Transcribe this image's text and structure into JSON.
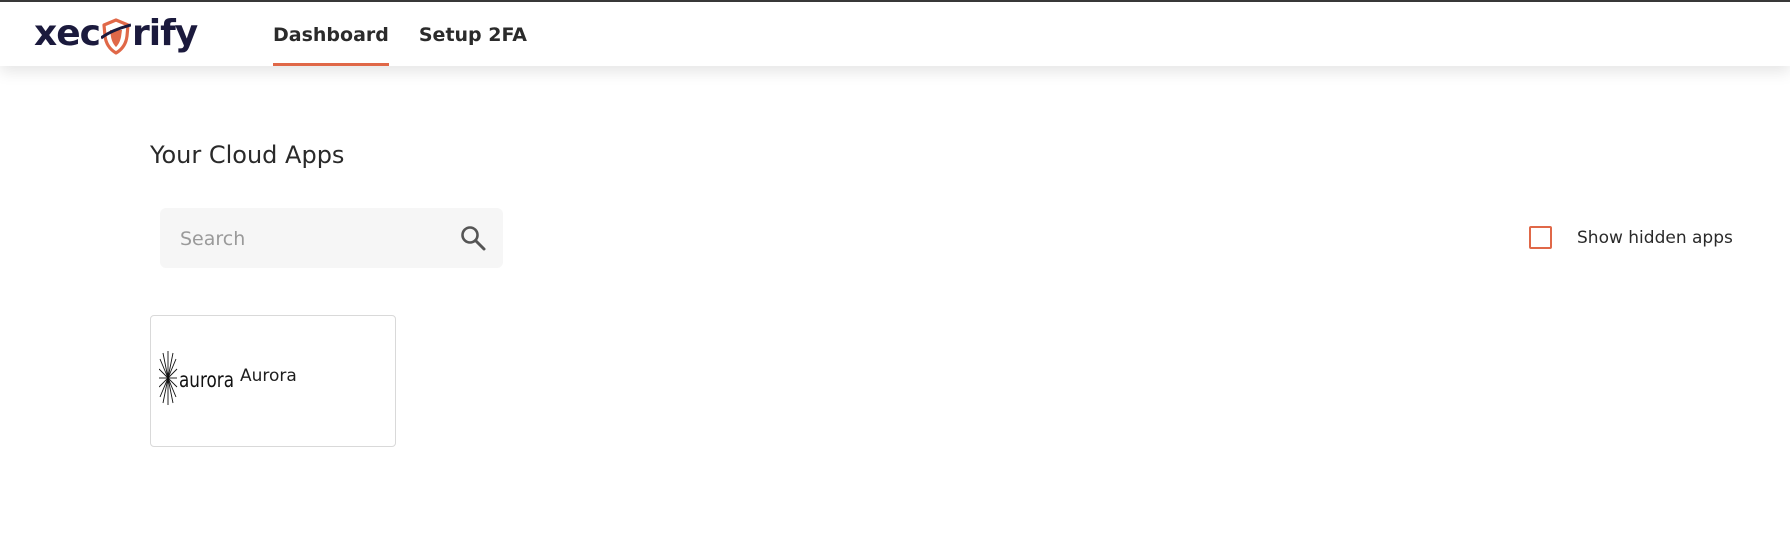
{
  "brand": {
    "logo_text_before": "xec",
    "logo_text_after": "rify",
    "logo_full": "xecurify",
    "primary_color": "#1b1a3d",
    "accent_color": "#e06848"
  },
  "nav": {
    "tabs": [
      {
        "label": "Dashboard",
        "active": true
      },
      {
        "label": "Setup 2FA",
        "active": false
      }
    ]
  },
  "main": {
    "title": "Your Cloud Apps",
    "search": {
      "placeholder": "Search",
      "value": "",
      "icon": "search-icon"
    },
    "show_hidden": {
      "label": "Show hidden apps",
      "checked": false
    },
    "apps": [
      {
        "name": "Aurora",
        "logo_text": "aurora",
        "icon": "aurora-logo"
      }
    ]
  }
}
